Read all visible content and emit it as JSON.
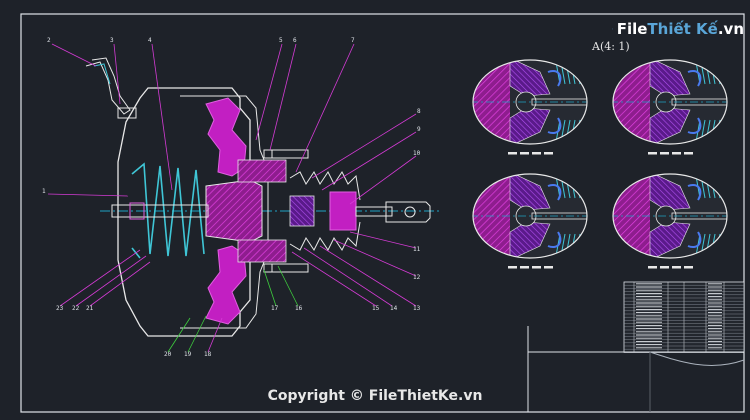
{
  "logo": {
    "brand_a": "File",
    "brand_b": "Thiết Kế",
    "domain": ".vn"
  },
  "copyright": "Copyright © FileThietKe.vn",
  "detail_view_title": "A(4: 1)",
  "part_numbers": [
    "1",
    "2",
    "3",
    "4",
    "5",
    "6",
    "7",
    "8",
    "9",
    "10",
    "11",
    "12",
    "13",
    "14",
    "15",
    "16",
    "17",
    "18",
    "19",
    "20",
    "21",
    "22",
    "23"
  ],
  "colors": {
    "background": "#1e2229",
    "frame": "#dfe3e8",
    "part_outline": "#e8e8e8",
    "hatch_magenta": "#c21fc2",
    "spring_cyan": "#3fc6d6",
    "leader_magenta": "#d43bd4",
    "leader_green": "#3ecf3e",
    "centerline": "#1fa3c4"
  }
}
